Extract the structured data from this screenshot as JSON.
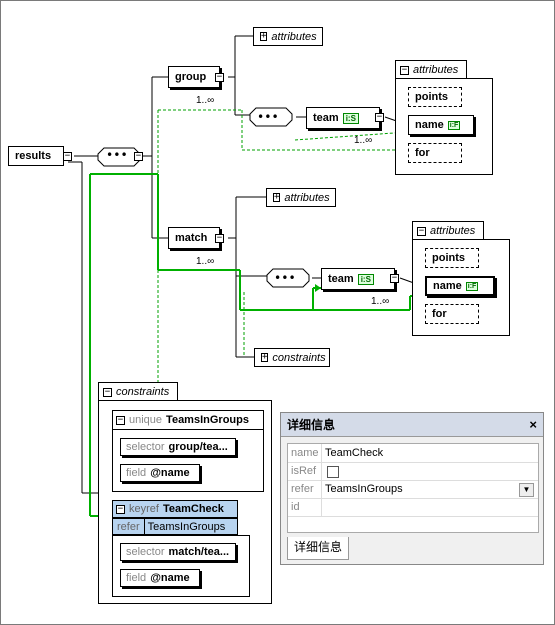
{
  "root": {
    "label": "results"
  },
  "group": {
    "label": "group",
    "occ": "1..∞"
  },
  "match": {
    "label": "match",
    "occ": "1..∞"
  },
  "top_attributes_1": {
    "label": "attributes"
  },
  "top_attributes_2": {
    "label": "attributes"
  },
  "team_group": {
    "label": "team",
    "occ": "1..∞"
  },
  "team_match": {
    "label": "team",
    "occ": "1..∞"
  },
  "attr_panel_group": {
    "header": "attributes",
    "items": [
      "points",
      "name",
      "for"
    ]
  },
  "attr_panel_match": {
    "header": "attributes",
    "items": [
      "points",
      "name",
      "for"
    ]
  },
  "match_constraints": {
    "label": "constraints"
  },
  "constraints_panel": {
    "header": "constraints",
    "unique": {
      "kind": "unique",
      "name": "TeamsInGroups",
      "selector_key": "selector",
      "selector_val": "group/tea...",
      "field_key": "field",
      "field_val": "@name"
    },
    "keyref": {
      "kind": "keyref",
      "name": "TeamCheck",
      "refer_key": "refer",
      "refer_val": "TeamsInGroups",
      "selector_key": "selector",
      "selector_val": "match/tea...",
      "field_key": "field",
      "field_val": "@name"
    }
  },
  "details": {
    "title": "详细信息",
    "rows": [
      {
        "key": "name",
        "value": "TeamCheck"
      },
      {
        "key": "isRef",
        "value": ""
      },
      {
        "key": "refer",
        "value": "TeamsInGroups"
      },
      {
        "key": "id",
        "value": ""
      }
    ],
    "tab": "详细信息",
    "close": "×"
  },
  "colors": {
    "keyref_highlight": "#00b000",
    "constraint_dashed": "#00a000",
    "keyref_bg": "#b8d4f0"
  }
}
